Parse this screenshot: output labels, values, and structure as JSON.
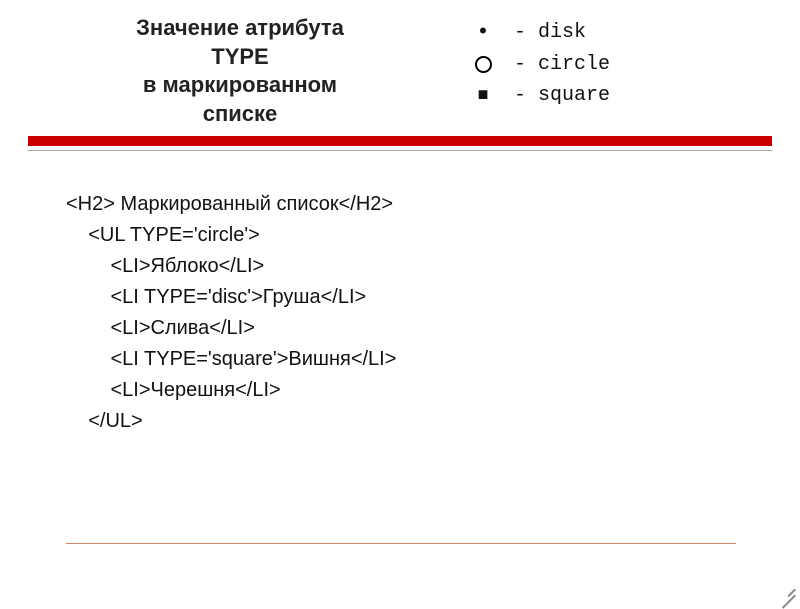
{
  "title": {
    "line1": "Значение атрибута",
    "line2": "TYPE",
    "line3": "в маркированном",
    "line4": "списке"
  },
  "legend": [
    {
      "marker": "disc",
      "text": "- disk"
    },
    {
      "marker": "circle",
      "text": "- circle"
    },
    {
      "marker": "square",
      "text": "- square"
    }
  ],
  "code": {
    "l0": "<H2> Маркированный список</H2>",
    "l1": "    <UL TYPE='circle'>",
    "l2": "        <LI>Яблоко</LI>",
    "l3": "        <LI TYPE='disc'>Груша</LI>",
    "l4": "        <LI>Слива</LI>",
    "l5": "        <LI TYPE='square'>Вишня</LI>",
    "l6": "        <LI>Черешня</LI>",
    "l7": "    </UL>"
  }
}
